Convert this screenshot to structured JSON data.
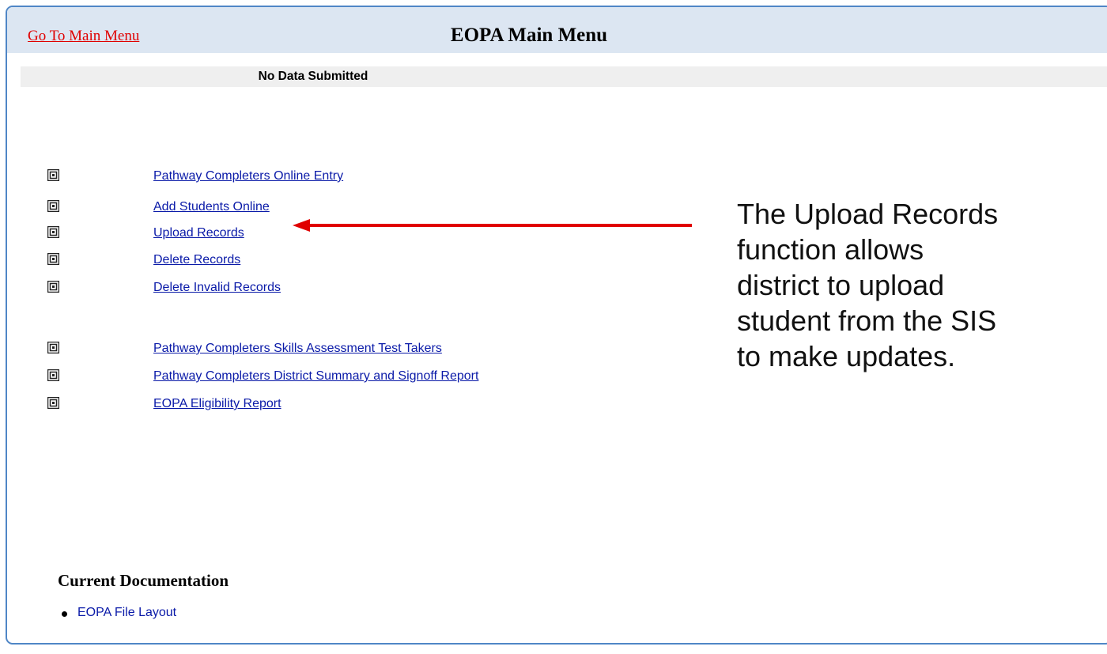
{
  "header": {
    "go_main_link": "Go To Main Menu",
    "title": "EOPA Main Menu"
  },
  "status": "No Data Submitted",
  "menu": {
    "group1": [
      {
        "label": "Pathway Completers Online Entry",
        "icon": "menu-square-icon"
      },
      {
        "label": "Add Students Online",
        "icon": "menu-square-icon"
      },
      {
        "label": "Upload Records",
        "icon": "menu-square-icon"
      },
      {
        "label": "Delete Records",
        "icon": "menu-square-icon"
      },
      {
        "label": "Delete Invalid Records",
        "icon": "menu-square-icon"
      }
    ],
    "group2": [
      {
        "label": "Pathway Completers Skills Assessment Test Takers",
        "icon": "menu-square-icon"
      },
      {
        "label": "Pathway Completers District Summary and Signoff Report",
        "icon": "menu-square-icon"
      },
      {
        "label": "EOPA Eligibility Report",
        "icon": "menu-square-icon"
      }
    ]
  },
  "callout": {
    "text": "The Upload Records function allows district to upload student from the SIS to make updates.",
    "arrow_color": "#e00000",
    "arrow_target": "Upload Records"
  },
  "documentation": {
    "heading": "Current Documentation",
    "items": [
      {
        "label": "EOPA File Layout"
      }
    ]
  },
  "colors": {
    "header_bg": "#dce6f2",
    "frame_border": "#4f86c6",
    "link": "#0a1aa8",
    "go_main_link": "#e00000",
    "status_bg": "#efefef"
  }
}
